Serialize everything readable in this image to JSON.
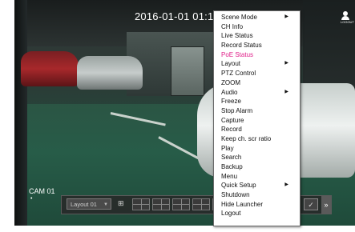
{
  "osd": {
    "timestamp": "2016-01-01 01:10",
    "camera_name": "CAM 01",
    "camera_sub": "•",
    "user_caption": "LOGOUT"
  },
  "launcher": {
    "layout_value": "Layout 01",
    "extra_icon": "✓",
    "expand_arrow": "»",
    "grid_buttons": [
      "grid-2x2",
      "grid-2x2",
      "grid-2x2",
      "grid-2x2",
      "grid-2x2"
    ]
  },
  "context_menu": {
    "items": [
      {
        "label": "Scene Mode",
        "submenu": true
      },
      {
        "label": "CH Info",
        "submenu": false
      },
      {
        "label": "Live Status",
        "submenu": false
      },
      {
        "label": "Record Status",
        "submenu": false
      },
      {
        "label": "PoE Status",
        "submenu": false,
        "active": true
      },
      {
        "label": "Layout",
        "submenu": true
      },
      {
        "label": "PTZ Control",
        "submenu": false
      },
      {
        "label": "ZOOM",
        "submenu": false
      },
      {
        "label": "Audio",
        "submenu": true
      },
      {
        "label": "Freeze",
        "submenu": false
      },
      {
        "label": "Stop Alarm",
        "submenu": false
      },
      {
        "label": "Capture",
        "submenu": false
      },
      {
        "label": "Record",
        "submenu": false
      },
      {
        "label": "Keep ch. scr ratio",
        "submenu": false
      },
      {
        "label": "Play",
        "submenu": false
      },
      {
        "label": "Search",
        "submenu": false
      },
      {
        "label": "Backup",
        "submenu": false
      },
      {
        "label": "Menu",
        "submenu": false
      },
      {
        "label": "Quick Setup",
        "submenu": true
      },
      {
        "label": "Shutdown",
        "submenu": false
      },
      {
        "label": "Hide Launcher",
        "submenu": false
      },
      {
        "label": "Logout",
        "submenu": false
      }
    ],
    "submenu_glyph": "▶",
    "active_color": "#e0208a"
  }
}
